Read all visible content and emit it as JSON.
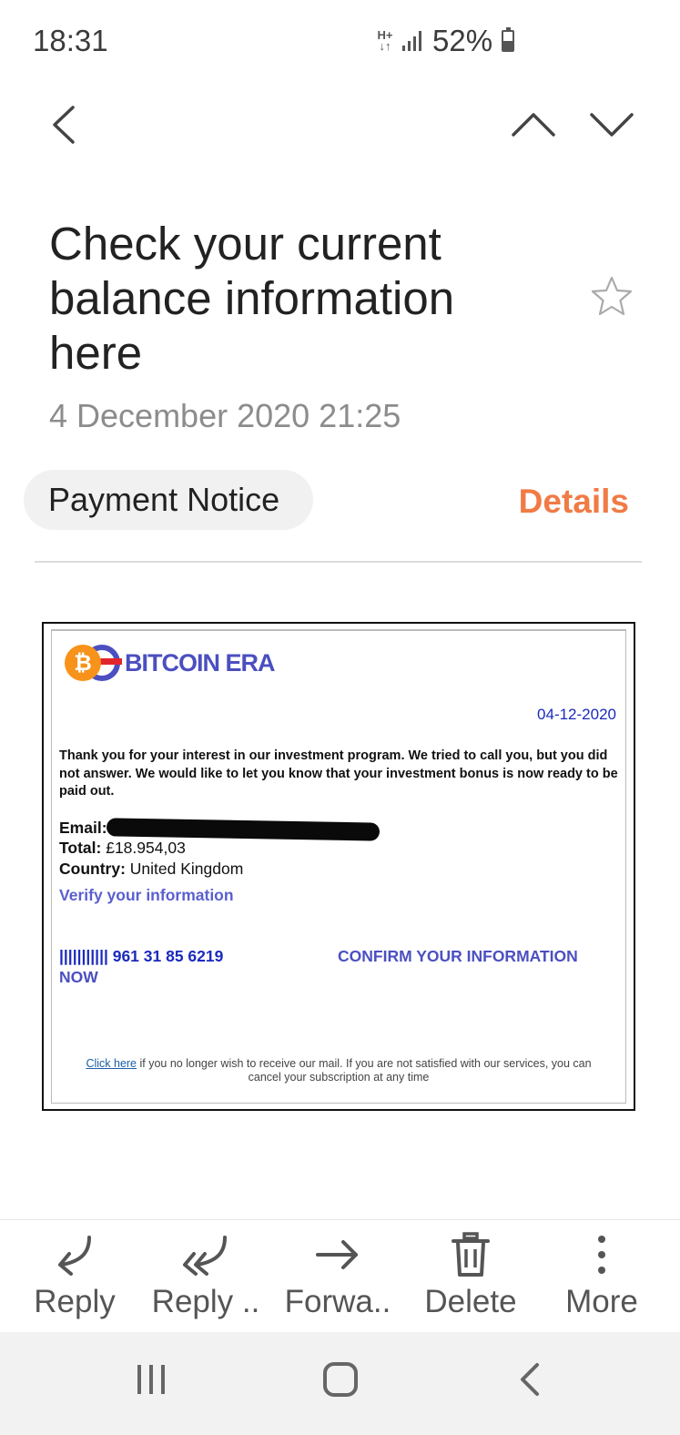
{
  "status_bar": {
    "time": "18:31",
    "network": "H+",
    "battery_percent": "52%",
    "battery_level": 0.52
  },
  "header_nav": {
    "back_icon": "chevron-left-icon",
    "prev_icon": "chevron-up-icon",
    "next_icon": "chevron-down-icon"
  },
  "message": {
    "subject": "Check your current balance information here",
    "date": "4 December 2020  21:25",
    "sender_chip": "Payment Notice",
    "details_label": "Details",
    "starred": false
  },
  "email": {
    "logo_text": "BITCOIN ERA",
    "date": "04-12-2020",
    "body": "Thank you for your interest in our investment program. We tried to call you, but you did not answer. We would like to let you know that your investment bonus is now ready to be paid out.",
    "email_label": "Email:",
    "total_label": "Total:",
    "total_value": "£18.954,03",
    "country_label": "Country:",
    "country_value": "United Kingdom",
    "verify_link": "Verify your information",
    "barcode_text": "||||||||||| 961 31 85 6219",
    "confirm_link_part1": "CONFIRM YOUR INFORMATION",
    "confirm_link_part2": "NOW",
    "footer_link": "Click here",
    "footer_text": " if you no longer wish to receive our mail. If you are not satisfied with our services, you can cancel your subscription at any time"
  },
  "toolbar": {
    "reply": "Reply",
    "reply_all": "Reply ..",
    "forward": "Forwa..",
    "delete": "Delete",
    "more": "More"
  },
  "colors": {
    "accent": "#f07b45",
    "brand_blue": "#4b4fc0",
    "link_blue": "#1b2abd"
  }
}
